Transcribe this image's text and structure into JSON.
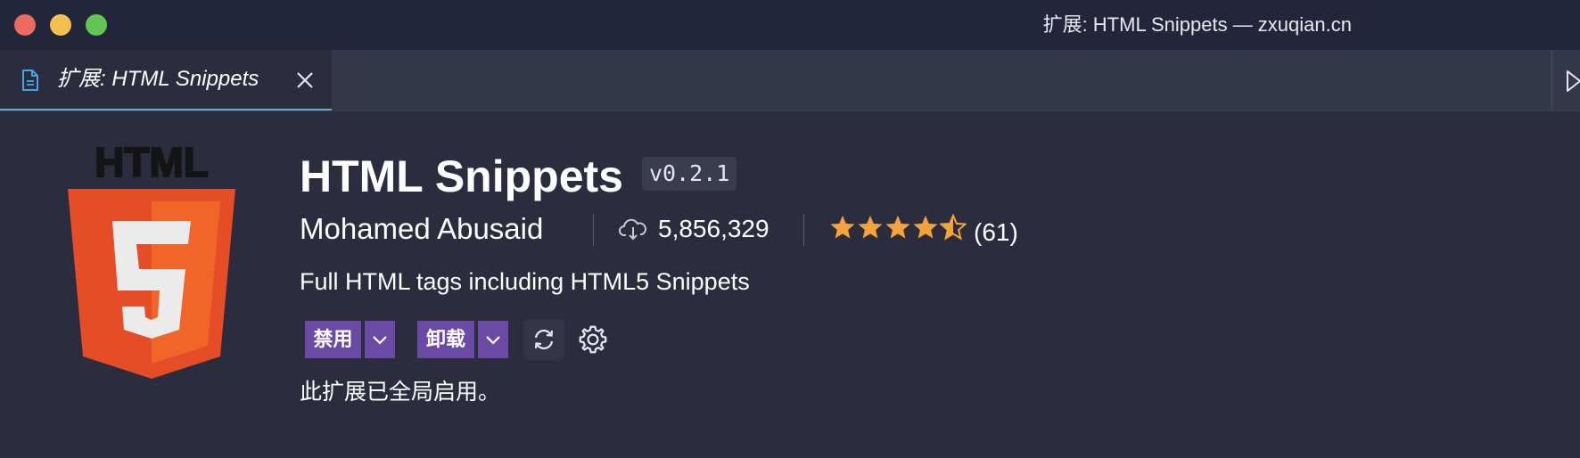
{
  "window": {
    "title": "扩展: HTML Snippets — zxuqian.cn"
  },
  "tab": {
    "label": "扩展: HTML Snippets"
  },
  "extension": {
    "logo_text": "HTML",
    "name": "HTML Snippets",
    "version": "v0.2.1",
    "publisher": "Mohamed Abusaid",
    "installs": "5,856,329",
    "rating": 4.5,
    "rating_count": "(61)",
    "description": "Full HTML tags including HTML5 Snippets",
    "status": "此扩展已全局启用。"
  },
  "actions": {
    "disable_label": "禁用",
    "uninstall_label": "卸载"
  },
  "colors": {
    "accent_button": "#6b4aa6",
    "star": "#f2a33c",
    "tab_underline": "#5fb3c8",
    "background": "#2b2d3e"
  }
}
